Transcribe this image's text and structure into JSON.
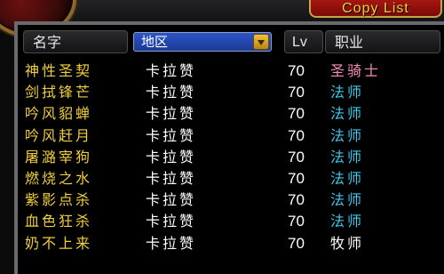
{
  "top_bar": {
    "copy_list_label": "Copy List"
  },
  "columns": {
    "name": "名字",
    "region": "地区",
    "level": "Lv",
    "class": "职业"
  },
  "class_colors": {
    "圣骑士": "#f58cba",
    "法师": "#3fc7eb",
    "牧师": "#ffffff"
  },
  "rows": [
    {
      "name": "神性圣契",
      "region": "卡拉赞",
      "level": "70",
      "class": "圣骑士",
      "class_color": "#f58cba"
    },
    {
      "name": "剑拭锋芒",
      "region": "卡拉赞",
      "level": "70",
      "class": "法师",
      "class_color": "#3fc7eb"
    },
    {
      "name": "吟风貂蝉",
      "region": "卡拉赞",
      "level": "70",
      "class": "法师",
      "class_color": "#3fc7eb"
    },
    {
      "name": "吟风赶月",
      "region": "卡拉赞",
      "level": "70",
      "class": "法师",
      "class_color": "#3fc7eb"
    },
    {
      "name": "屠潞宰狗",
      "region": "卡拉赞",
      "level": "70",
      "class": "法师",
      "class_color": "#3fc7eb"
    },
    {
      "name": "燃烧之水",
      "region": "卡拉赞",
      "level": "70",
      "class": "法师",
      "class_color": "#3fc7eb"
    },
    {
      "name": "紫影点杀",
      "region": "卡拉赞",
      "level": "70",
      "class": "法师",
      "class_color": "#3fc7eb"
    },
    {
      "name": "血色狂杀",
      "region": "卡拉赞",
      "level": "70",
      "class": "法师",
      "class_color": "#3fc7eb"
    },
    {
      "name": "奶不上来",
      "region": "卡拉赞",
      "level": "70",
      "class": "牧师",
      "class_color": "#ffffff"
    }
  ]
}
